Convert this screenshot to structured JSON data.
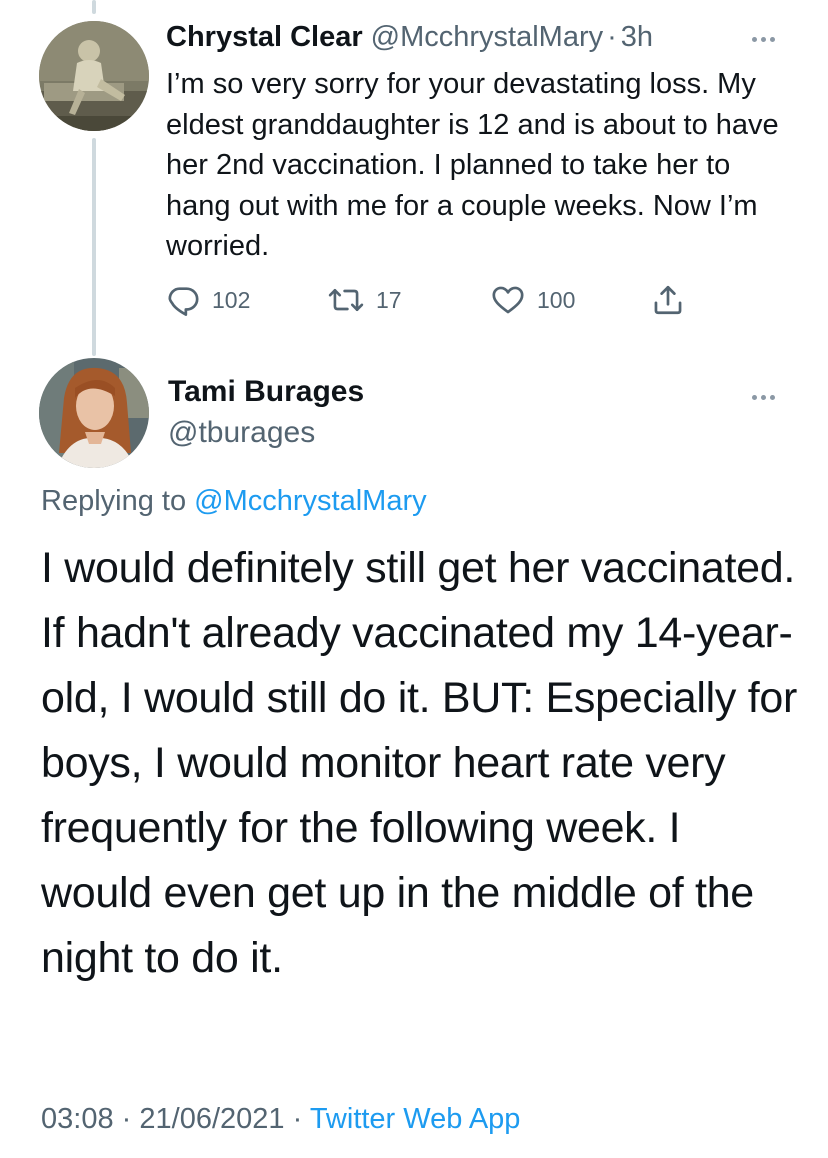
{
  "parent_tweet": {
    "author_name": "Chrystal Clear",
    "handle": "@McchrystalMary",
    "separator": "·",
    "time": "3h",
    "text": "I’m so very sorry for your devastating loss. My eldest granddaughter is 12 and is about to have her 2nd vaccination. I planned to take her to hang out with me for a couple weeks. Now I’m worried.",
    "stats": {
      "replies": "102",
      "retweets": "17",
      "likes": "100"
    },
    "icons": [
      "reply-icon",
      "retweet-icon",
      "like-icon",
      "share-icon",
      "more-icon"
    ]
  },
  "main_tweet": {
    "author_name": "Tami Burages",
    "handle": "@tburages",
    "replying_prefix": "Replying to",
    "replying_to": "@McchrystalMary",
    "text": "I would definitely still get her vaccinated. If hadn't already vaccinated my 14-year-old, I would still do it. BUT: Especially for boys, I would monitor heart rate very frequently for the following week. I would even get up in the middle of the night to do it.",
    "time": "03:08",
    "separator": "·",
    "date": "21/06/2021",
    "source": "Twitter Web App"
  },
  "colors": {
    "text_primary": "#0f1419",
    "text_secondary": "#536471",
    "link": "#1d9bf0",
    "thread_line": "#cfd9de"
  }
}
